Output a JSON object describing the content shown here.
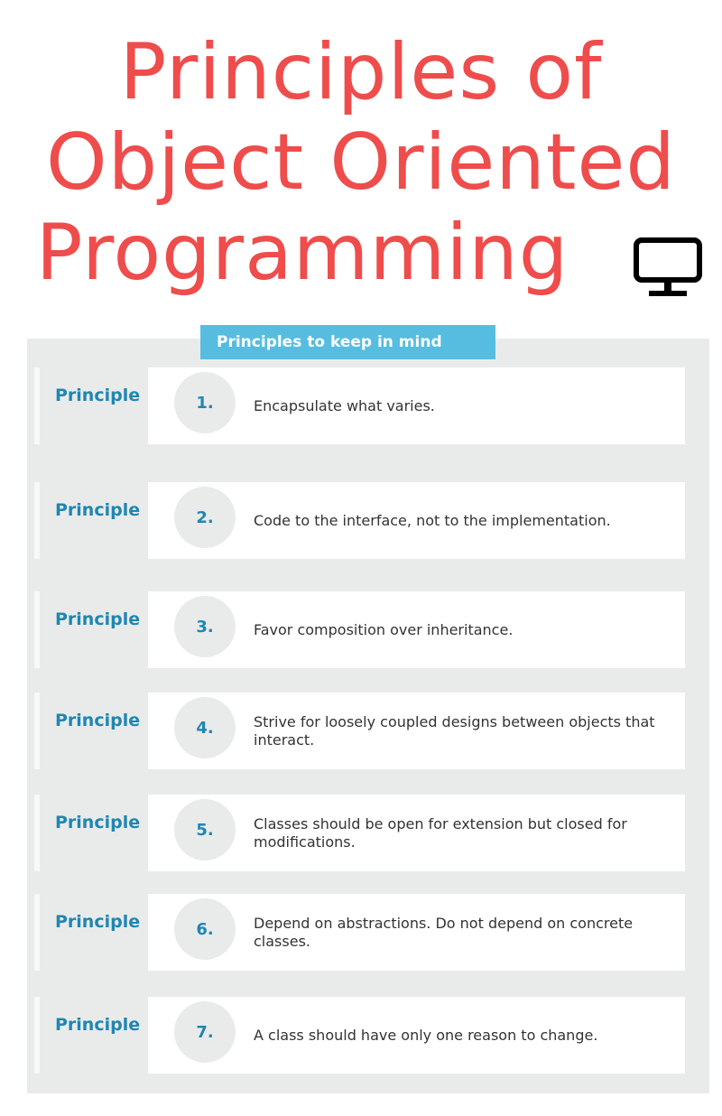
{
  "title": {
    "line1": "Principles of",
    "line2": "Object Oriented",
    "line3": "Programming"
  },
  "icon": "monitor-icon",
  "banner": "Principles to keep in mind",
  "colors": {
    "title": "#ef4c4c",
    "banner": "#56bde0",
    "label": "#1f86b3",
    "panel": "#e9ebea"
  },
  "principles": [
    {
      "label": "Principle",
      "number": "1.",
      "text": "Encapsulate what varies."
    },
    {
      "label": "Principle",
      "number": "2.",
      "text": "Code to the interface, not to the implementation."
    },
    {
      "label": "Principle",
      "number": "3.",
      "text": "Favor composition over inheritance."
    },
    {
      "label": "Principle",
      "number": "4.",
      "text": "Strive for loosely coupled designs between objects that interact."
    },
    {
      "label": "Principle",
      "number": "5.",
      "text": "Classes should be open for extension but closed for modifications."
    },
    {
      "label": "Principle",
      "number": "6.",
      "text": "Depend on abstractions. Do not depend on concrete classes."
    },
    {
      "label": "Principle",
      "number": "7.",
      "text": "A class should have only one reason to change."
    }
  ]
}
